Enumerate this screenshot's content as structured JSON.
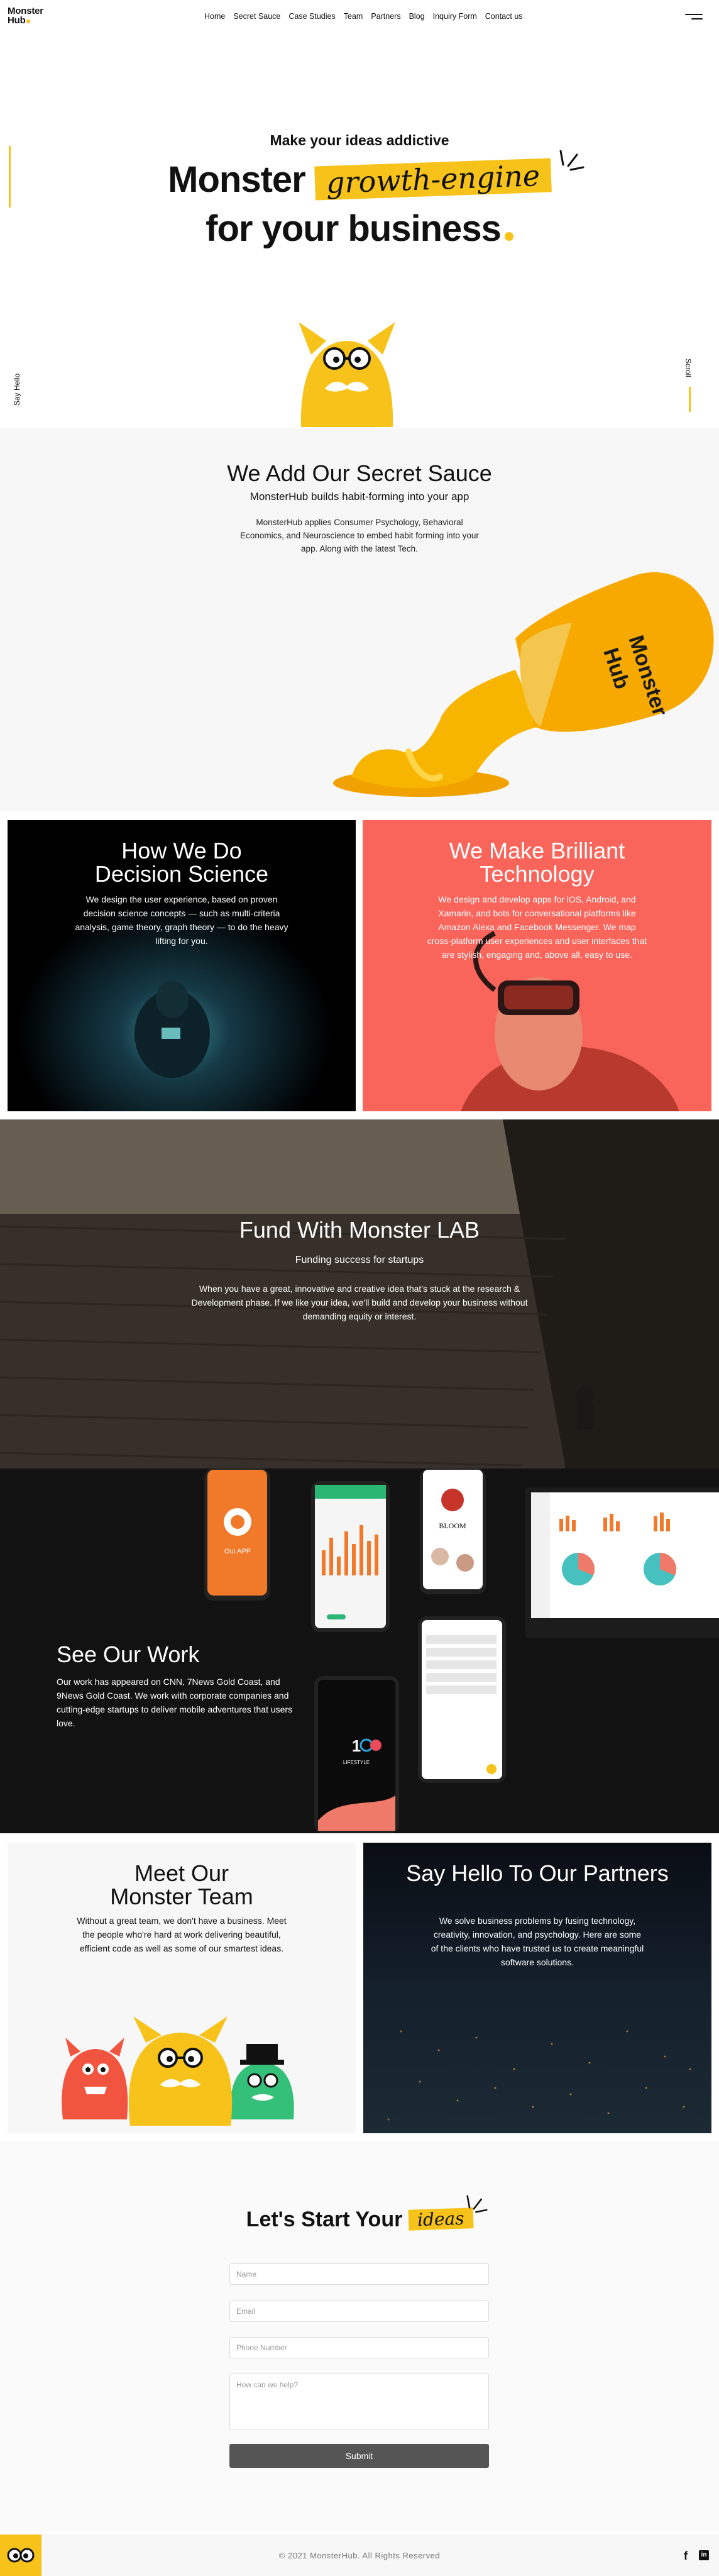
{
  "header": {
    "logo_line1": "Monster",
    "logo_line2": "Hub",
    "nav": [
      "Home",
      "Secret Sauce",
      "Case Studies",
      "Team",
      "Partners",
      "Blog",
      "Inquiry Form",
      "Contact us"
    ],
    "menu_icon": "hamburger-icon"
  },
  "hero": {
    "tagline": "Make your ideas addictive",
    "headline_pre": "Monster",
    "headline_highlight": "growth-engine",
    "headline_line2": "for your business",
    "say_hello": "Say Hello",
    "scroll": "Scroll"
  },
  "sauce": {
    "title": "We Add Our Secret Sauce",
    "subtitle": "MonsterHub builds habit-forming into your app",
    "description": "MonsterHub applies Consumer Psychology, Behavioral Economics, and Neuroscience to embed habit forming into your app. Along with the latest Tech.",
    "bottle_label_line1": "Monster",
    "bottle_label_line2": "Hub"
  },
  "decision": {
    "title_line1": "How We Do",
    "title_line2": "Decision Science",
    "description": "We design the user experience, based on proven decision science concepts — such as multi-criteria analysis, game theory, graph theory — to do the heavy lifting for you."
  },
  "technology": {
    "title_line1": "We Make Brilliant",
    "title_line2": "Technology",
    "description": "We design and develop apps for iOS, Android, and Xamarin, and bots for conversational platforms like Amazon Alexa and Facebook Messenger. We map cross-platform user experiences and user interfaces that are stylish, engaging and, above all, easy to use."
  },
  "fund": {
    "title": "Fund With Monster LAB",
    "subtitle": "Funding success for startups",
    "description": "When you have a great, innovative and creative idea that's stuck at the research & Development phase. If we like your idea, we'll build and develop your business without demanding equity or interest."
  },
  "work": {
    "title": "See Our Work",
    "description": "Our work has appeared on CNN, 7News Gold Coast, and 9News Gold Coast. We work with corporate companies and cutting-edge startups to deliver mobile adventures that users love.",
    "phone_app_label": "Out APP",
    "bloom_label": "BLOOM",
    "lifestyle_label": "LIFESTYLE"
  },
  "team": {
    "title_line1": "Meet Our",
    "title_line2": "Monster Team",
    "description": "Without a great team, we don't have a business. Meet the people who're hard at work delivering beautiful, efficient code as well as some of our smartest ideas."
  },
  "partners": {
    "title": "Say Hello To Our Partners",
    "description": "We solve business problems by fusing technology, creativity, innovation, and psychology. Here are some of the clients who have trusted us to create meaningful software solutions."
  },
  "contact": {
    "title_pre": "Let's Start Your",
    "title_highlight": "ideas",
    "name_placeholder": "Name",
    "email_placeholder": "Email",
    "phone_placeholder": "Phone Number",
    "message_placeholder": "How can we help?",
    "submit_label": "Submit"
  },
  "footer": {
    "copyright": "© 2021 MonsterHub. All Rights Reserved",
    "facebook": "f",
    "linkedin": "in"
  },
  "colors": {
    "brand_yellow": "#f7c21a",
    "coral": "#f9655b",
    "dark": "#121212"
  }
}
